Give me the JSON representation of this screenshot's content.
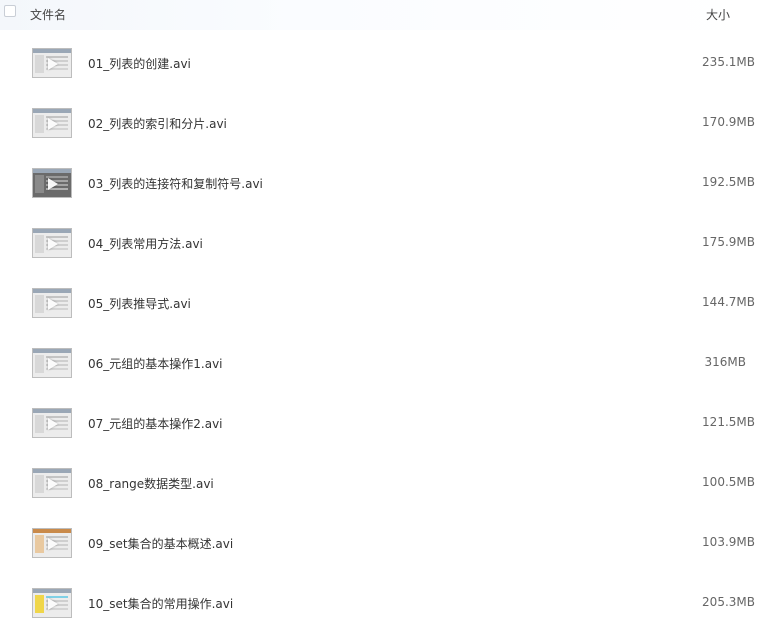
{
  "header": {
    "name_label": "文件名",
    "size_label": "大小"
  },
  "files": [
    {
      "name": "01_列表的创建.avi",
      "size": "235.1MB",
      "thumb": "light"
    },
    {
      "name": "02_列表的索引和分片.avi",
      "size": "170.9MB",
      "thumb": "light"
    },
    {
      "name": "03_列表的连接符和复制符号.avi",
      "size": "192.5MB",
      "thumb": "dark"
    },
    {
      "name": "04_列表常用方法.avi",
      "size": "175.9MB",
      "thumb": "light"
    },
    {
      "name": "05_列表推导式.avi",
      "size": "144.7MB",
      "thumb": "light"
    },
    {
      "name": "06_元组的基本操作1.avi",
      "size": "316MB",
      "thumb": "light"
    },
    {
      "name": "07_元组的基本操作2.avi",
      "size": "121.5MB",
      "thumb": "light"
    },
    {
      "name": "08_range数据类型.avi",
      "size": "100.5MB",
      "thumb": "light"
    },
    {
      "name": "09_set集合的基本概述.avi",
      "size": "103.9MB",
      "thumb": "orange"
    },
    {
      "name": "10_set集合的常用操作.avi",
      "size": "205.3MB",
      "thumb": "accent"
    }
  ],
  "colors": {
    "header_bg": "#f4f7fb",
    "text": "#333333",
    "size_text": "#666666"
  },
  "icons": {
    "file_thumb": "video-thumbnail-icon",
    "play": "play-icon",
    "checkbox": "checkbox-icon"
  }
}
